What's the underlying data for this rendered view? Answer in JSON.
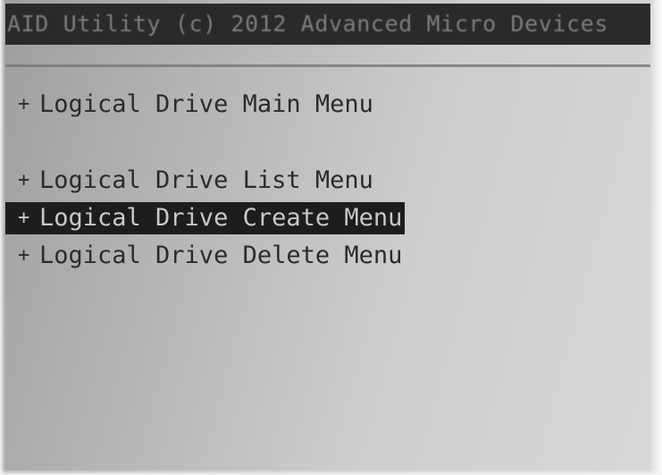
{
  "header": {
    "title": "AID Utility (c) 2012 Advanced Micro Devices"
  },
  "menu": {
    "items": [
      {
        "bullet": "+",
        "label": "Logical Drive Main Menu",
        "selected": false
      },
      {
        "bullet": "+",
        "label": "Logical Drive List Menu",
        "selected": false
      },
      {
        "bullet": "+",
        "label": "Logical Drive Create Menu",
        "selected": true
      },
      {
        "bullet": "+",
        "label": "Logical Drive Delete Menu",
        "selected": false
      }
    ]
  },
  "colors": {
    "background": "#c4c4c4",
    "title_bar": "#2a2a2a",
    "selection": "#1d1d1d",
    "text": "#2b2b2b"
  }
}
